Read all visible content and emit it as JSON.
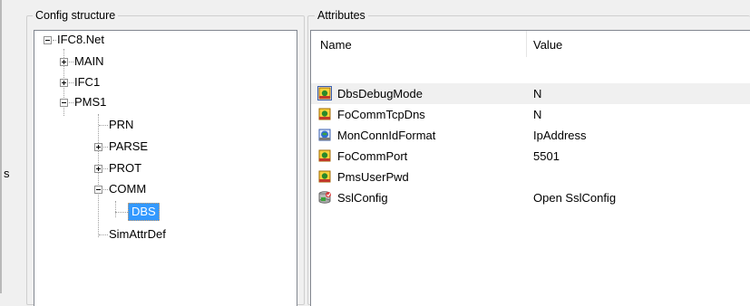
{
  "left_panel": {
    "title": "Config structure",
    "tree": [
      {
        "label": "IFC8.Net",
        "expander": "minus"
      },
      {
        "label": "MAIN",
        "expander": "plus"
      },
      {
        "label": "IFC1",
        "expander": "plus"
      },
      {
        "label": "PMS1",
        "expander": "minus"
      },
      {
        "label": "PRN",
        "expander": "none"
      },
      {
        "label": "PARSE",
        "expander": "plus"
      },
      {
        "label": "PROT",
        "expander": "plus"
      },
      {
        "label": "COMM",
        "expander": "minus"
      },
      {
        "label": "DBS",
        "expander": "none",
        "selected": true
      },
      {
        "label": "SimAttrDef",
        "expander": "none"
      }
    ]
  },
  "right_panel": {
    "title": "Attributes",
    "columns": {
      "name": "Name",
      "value": "Value"
    },
    "rows": [
      {
        "icon": "attribute-icon",
        "name": "DbsDebugMode",
        "value": "N"
      },
      {
        "icon": "attribute-icon",
        "name": "FoCommTcpDns",
        "value": "N"
      },
      {
        "icon": "globe-attribute-icon",
        "name": "MonConnIdFormat",
        "value": "IpAddress"
      },
      {
        "icon": "attribute-icon",
        "name": "FoCommPort",
        "value": "5501"
      },
      {
        "icon": "attribute-icon",
        "name": "PmsUserPwd",
        "value": ""
      },
      {
        "icon": "ssl-config-icon",
        "name": "SslConfig",
        "value": "Open SslConfig"
      }
    ]
  },
  "stray_char": "s",
  "colors": {
    "selection": "#3399ff",
    "panel_bg": "#f0f0f0",
    "list_bg": "#ffffff"
  }
}
